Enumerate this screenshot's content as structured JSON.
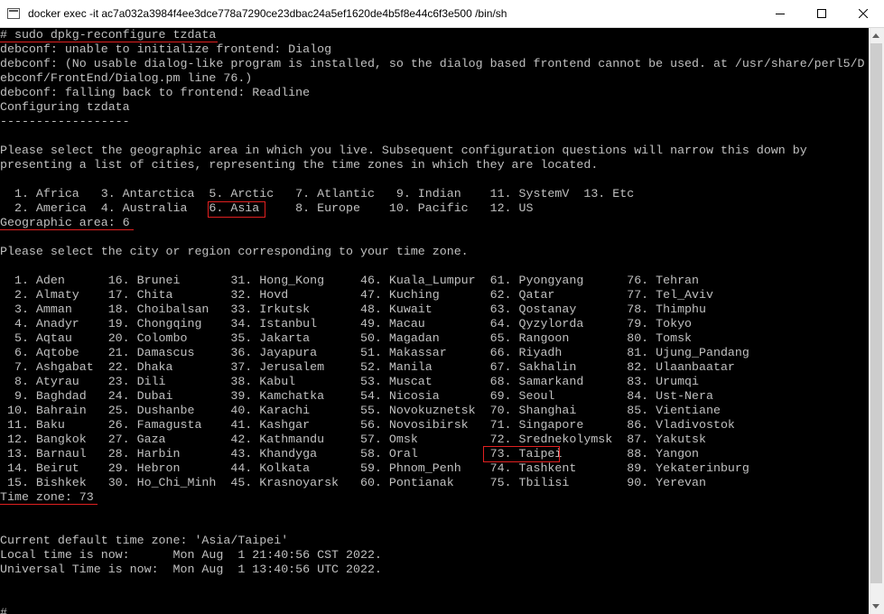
{
  "window": {
    "title": "docker  exec -it ac7a032a3984f4ee3dce778a7290ce23dbac24a5ef1620de4b5f8e44c6f3e500 /bin/sh",
    "icon": "terminal-app-icon",
    "controls": {
      "minimize": "minimize-icon",
      "maximize": "maximize-icon",
      "close": "close-icon"
    }
  },
  "terminal": {
    "lines": [
      "# sudo dpkg-reconfigure tzdata",
      "debconf: unable to initialize frontend: Dialog",
      "debconf: (No usable dialog-like program is installed, so the dialog based frontend cannot be used. at /usr/share/perl5/D",
      "ebconf/FrontEnd/Dialog.pm line 76.)",
      "debconf: falling back to frontend: Readline",
      "Configuring tzdata",
      "------------------",
      "",
      "Please select the geographic area in which you live. Subsequent configuration questions will narrow this down by",
      "presenting a list of cities, representing the time zones in which they are located.",
      "",
      "  1. Africa   3. Antarctica  5. Arctic   7. Atlantic   9. Indian    11. SystemV  13. Etc",
      "  2. America  4. Australia   6. Asia     8. Europe    10. Pacific   12. US",
      "Geographic area: 6",
      "",
      "Please select the city or region corresponding to your time zone.",
      "",
      "  1. Aden      16. Brunei       31. Hong_Kong     46. Kuala_Lumpur  61. Pyongyang      76. Tehran",
      "  2. Almaty    17. Chita        32. Hovd          47. Kuching       62. Qatar          77. Tel_Aviv",
      "  3. Amman     18. Choibalsan   33. Irkutsk       48. Kuwait        63. Qostanay       78. Thimphu",
      "  4. Anadyr    19. Chongqing    34. Istanbul      49. Macau         64. Qyzylorda      79. Tokyo",
      "  5. Aqtau     20. Colombo      35. Jakarta       50. Magadan       65. Rangoon        80. Tomsk",
      "  6. Aqtobe    21. Damascus     36. Jayapura      51. Makassar      66. Riyadh         81. Ujung_Pandang",
      "  7. Ashgabat  22. Dhaka        37. Jerusalem     52. Manila        67. Sakhalin       82. Ulaanbaatar",
      "  8. Atyrau    23. Dili         38. Kabul         53. Muscat        68. Samarkand      83. Urumqi",
      "  9. Baghdad   24. Dubai        39. Kamchatka     54. Nicosia       69. Seoul          84. Ust-Nera",
      " 10. Bahrain   25. Dushanbe     40. Karachi       55. Novokuznetsk  70. Shanghai       85. Vientiane",
      " 11. Baku      26. Famagusta    41. Kashgar       56. Novosibirsk   71. Singapore      86. Vladivostok",
      " 12. Bangkok   27. Gaza         42. Kathmandu     57. Omsk          72. Srednekolymsk  87. Yakutsk",
      " 13. Barnaul   28. Harbin       43. Khandyga      58. Oral          73. Taipei         88. Yangon",
      " 14. Beirut    29. Hebron       44. Kolkata       59. Phnom_Penh    74. Tashkent       89. Yekaterinburg",
      " 15. Bishkek   30. Ho_Chi_Minh  45. Krasnoyarsk   60. Pontianak     75. Tbilisi        90. Yerevan",
      "Time zone: 73",
      "",
      "",
      "Current default time zone: 'Asia/Taipei'",
      "Local time is now:      Mon Aug  1 21:40:56 CST 2022.",
      "Universal Time is now:  Mon Aug  1 13:40:56 UTC 2022.",
      "",
      "",
      "#"
    ]
  },
  "annotations": {
    "color": "#e02020",
    "underlined": [
      "# sudo dpkg-reconfigure tzdata",
      "Geographic area: 6",
      "Time zone: 73"
    ],
    "boxed": [
      "6. Asia",
      "73. Taipei"
    ]
  }
}
